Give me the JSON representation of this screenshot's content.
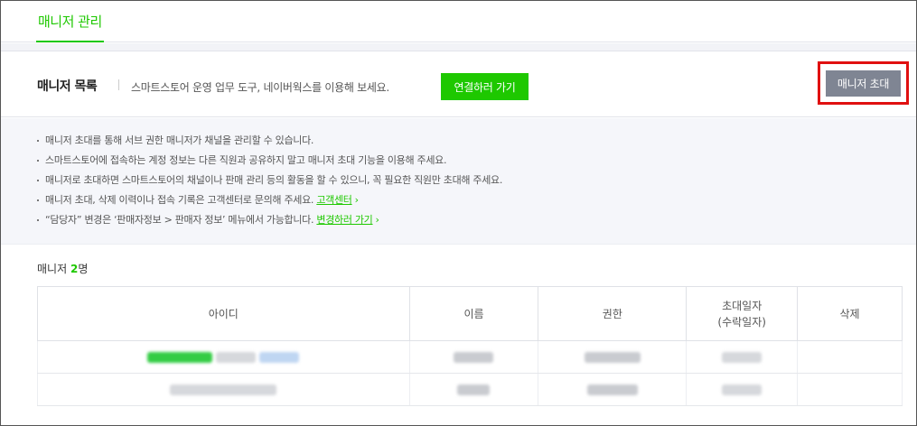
{
  "tabs": {
    "active": "매니저 관리"
  },
  "header": {
    "title": "매니저 목록",
    "description": "스마트스토어 운영 업무 도구, 네이버웍스를 이용해 보세요.",
    "connect_button": "연결하러 가기",
    "invite_button": "매니저 초대"
  },
  "notice": {
    "items": [
      {
        "text": "매니저 초대를 통해 서브 권한 매니저가 채널을 관리할 수 있습니다."
      },
      {
        "text": "스마트스토어에 접속하는 계정 정보는 다른 직원과 공유하지 말고 매니저 초대 기능을 이용해 주세요."
      },
      {
        "text": "매니저로 초대하면 스마트스토어의 채널이나 판매 관리 등의 활동을 할 수 있으니, 꼭 필요한 직원만 초대해 주세요."
      },
      {
        "text": "매니저 초대, 삭제 이력이나 접속 기록은 고객센터로 문의해 주세요.",
        "link": "고객센터"
      },
      {
        "text": "“담당자” 변경은 ‘판매자정보 > 판매자 정보’ 메뉴에서 가능합니다.",
        "link": "변경하러 가기"
      }
    ]
  },
  "managers": {
    "label": "매니저",
    "count": "2",
    "suffix": "명"
  },
  "table": {
    "columns": {
      "id": "아이디",
      "name": "이름",
      "role": "권한",
      "invite_date": "초대일자",
      "invite_date_sub": "(수락일자)",
      "delete": "삭제"
    }
  },
  "colors": {
    "accent": "#1ec800",
    "invite_button": "#7f8593",
    "highlight_border": "#e01010"
  }
}
